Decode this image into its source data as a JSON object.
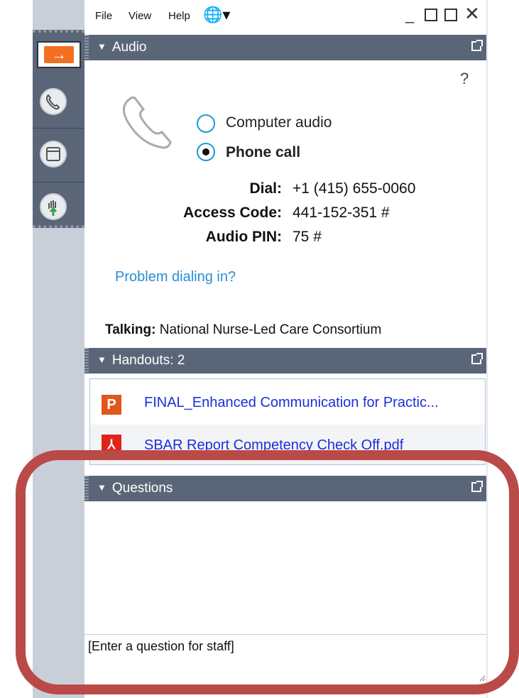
{
  "menu": {
    "file": "File",
    "view": "View",
    "help": "Help",
    "globe": "globe-icon"
  },
  "window_controls": [
    "minimize-icon",
    "restore-icon",
    "popout-icon",
    "close-icon"
  ],
  "sidebar": {
    "icons": [
      "exit-arrow-icon",
      "phone-icon",
      "window-icon",
      "raise-hand-icon"
    ]
  },
  "audio": {
    "header": "Audio",
    "help": "?",
    "options": [
      {
        "label": "Computer audio",
        "selected": false
      },
      {
        "label": "Phone call",
        "selected": true
      }
    ],
    "dial_label": "Dial:",
    "dial_value": "+1 (415) 655-0060",
    "access_label": "Access Code:",
    "access_value": "441-152-351 #",
    "pin_label": "Audio PIN:",
    "pin_value": "75 #",
    "problem_link": "Problem dialing in?",
    "talking_label": "Talking:",
    "talking_value": "National Nurse-Led Care Consortium"
  },
  "handouts": {
    "header": "Handouts: 2",
    "items": [
      {
        "icon": "powerpoint-icon",
        "icon_letter": "P",
        "name": "FINAL_Enhanced Communication for Practic..."
      },
      {
        "icon": "pdf-icon",
        "icon_letter": "⅄",
        "name": "SBAR Report Competency Check Off.pdf"
      }
    ]
  },
  "questions": {
    "header": "Questions",
    "input_placeholder": "[Enter a question for staff]"
  },
  "colors": {
    "header_bg": "#5a6678",
    "link": "#2a8dd4",
    "file_link": "#1b2fd8",
    "highlight": "#b94a48",
    "accent": "#f36f21"
  }
}
